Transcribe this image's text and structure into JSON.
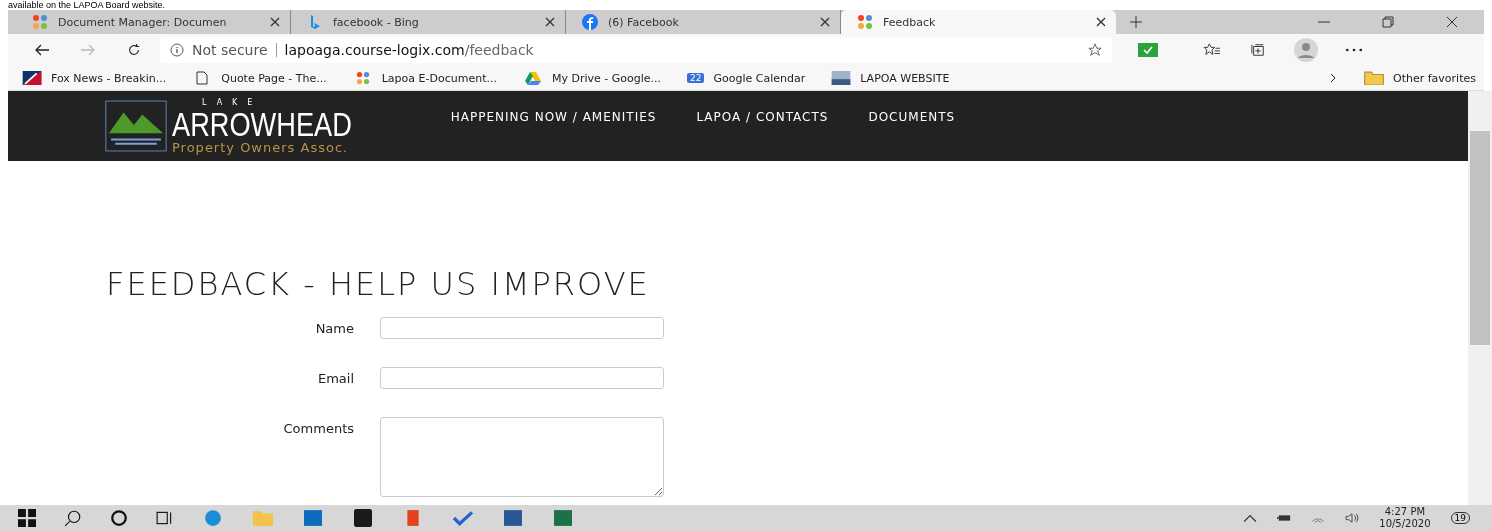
{
  "caption": "available on the LAPOA Board website.",
  "tabs": [
    {
      "title": "Document Manager: Documen",
      "selected": false
    },
    {
      "title": "facebook - Bing",
      "selected": false
    },
    {
      "title": "(6) Facebook",
      "selected": false
    },
    {
      "title": "Feedback",
      "selected": true
    }
  ],
  "address": {
    "security": "Not secure",
    "host": "lapoaga.course-logix.com",
    "path": "/feedback"
  },
  "bookmarks": [
    {
      "label": "Fox News - Breakin..."
    },
    {
      "label": "Quote Page - The..."
    },
    {
      "label": "Lapoa E-Document..."
    },
    {
      "label": "My Drive - Google..."
    },
    {
      "label": "Google Calendar",
      "badge": "22"
    },
    {
      "label": "LAPOA WEBSITE"
    }
  ],
  "other_favorites": "Other favorites",
  "site": {
    "logo_small": "LAKE",
    "logo_big": "ARROWHEAD",
    "logo_sub": "Property Owners Assoc.",
    "nav": [
      "HAPPENING NOW / AMENITIES",
      "LAPOA / CONTACTS",
      "DOCUMENTS"
    ]
  },
  "heading": "FEEDBACK - HELP US IMPROVE",
  "form": [
    {
      "label": "Name",
      "kind": "text"
    },
    {
      "label": "Email",
      "kind": "text"
    },
    {
      "label": "Comments",
      "kind": "textarea"
    }
  ],
  "taskbar": {
    "time": "4:27 PM",
    "date": "10/5/2020",
    "notifications": "19"
  }
}
